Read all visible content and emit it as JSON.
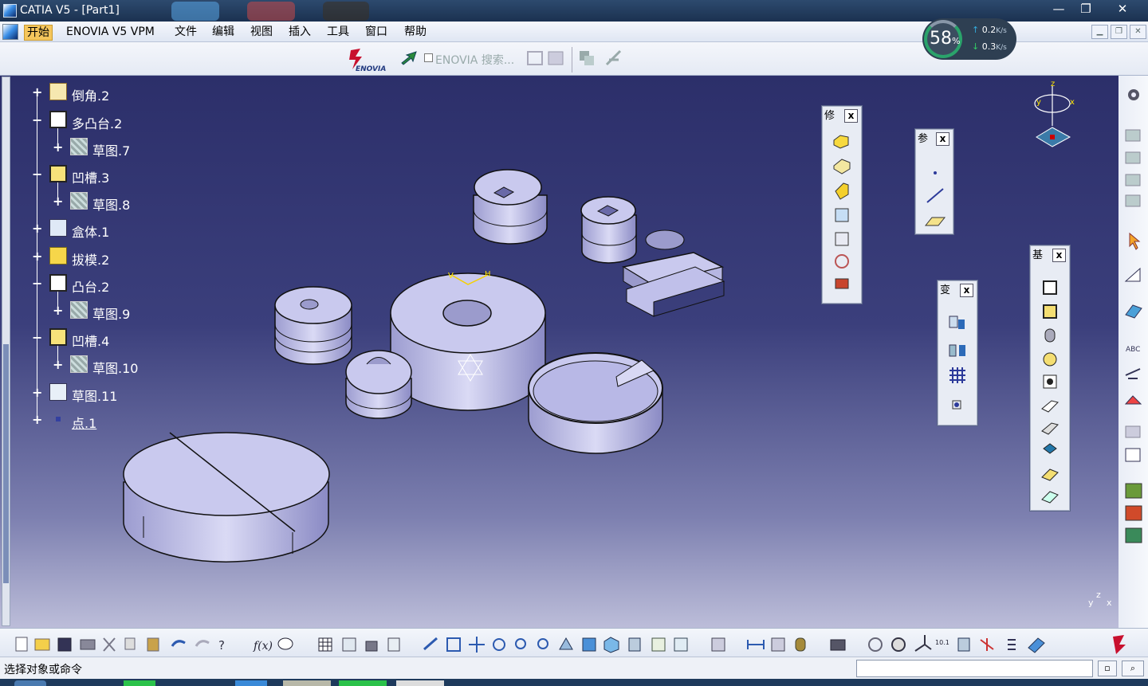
{
  "window": {
    "title": "CATIA V5 - [Part1]",
    "min": "—",
    "max": "❐",
    "close": "✕"
  },
  "menu": {
    "items": [
      {
        "id": "start",
        "label": "开始"
      },
      {
        "id": "enovia",
        "label": "ENOVIA V5 VPM"
      },
      {
        "id": "file",
        "label": "文件"
      },
      {
        "id": "edit",
        "label": "编辑"
      },
      {
        "id": "view",
        "label": "视图"
      },
      {
        "id": "insert",
        "label": "插入"
      },
      {
        "id": "tools",
        "label": "工具"
      },
      {
        "id": "window",
        "label": "窗口"
      },
      {
        "id": "help",
        "label": "帮助"
      }
    ]
  },
  "toolbar_top": {
    "enovia_logo": "ENOVIA",
    "enovia_search": "ENOVIA 搜索..."
  },
  "net_widget": {
    "percent": "58",
    "percent_unit": "%",
    "up": "0.2",
    "up_unit": "K/s",
    "down": "0.3",
    "down_unit": "K/s"
  },
  "tree": {
    "nodes": [
      {
        "label": "倒角.2",
        "icon": "chamfer-icon"
      },
      {
        "label": "多凸台.2",
        "icon": "multi-pad-icon"
      },
      {
        "label": "草图.7",
        "icon": "sketch-icon"
      },
      {
        "label": "凹槽.3",
        "icon": "pocket-icon"
      },
      {
        "label": "草图.8",
        "icon": "sketch-icon"
      },
      {
        "label": "盒体.1",
        "icon": "shell-icon"
      },
      {
        "label": "拔模.2",
        "icon": "draft-icon"
      },
      {
        "label": "凸台.2",
        "icon": "pad-icon"
      },
      {
        "label": "草图.9",
        "icon": "sketch-icon"
      },
      {
        "label": "凹槽.4",
        "icon": "pocket-icon"
      },
      {
        "label": "草图.10",
        "icon": "sketch-icon"
      },
      {
        "label": "草图.11",
        "icon": "sketch-icon"
      },
      {
        "label": "点.1",
        "icon": "point-icon"
      }
    ]
  },
  "palettes": {
    "modify": {
      "title": "修",
      "close": "x"
    },
    "reference": {
      "title": "参",
      "close": "x"
    },
    "transform": {
      "title": "变",
      "close": "x"
    },
    "base": {
      "title": "基",
      "close": "x"
    }
  },
  "compass": {
    "x": "x",
    "y": "y",
    "z": "z"
  },
  "viewport_axis": {
    "x": "x",
    "y": "y",
    "z": "z"
  },
  "sketch_axes": {
    "v": "V",
    "h": "H"
  },
  "status": {
    "text": "选择对象或命令"
  },
  "colors": {
    "viewport_top": "#2c2f6a",
    "viewport_bottom": "#bcbdd9",
    "part_fill": "#c9c9ee",
    "highlight": "#f5c65c"
  }
}
